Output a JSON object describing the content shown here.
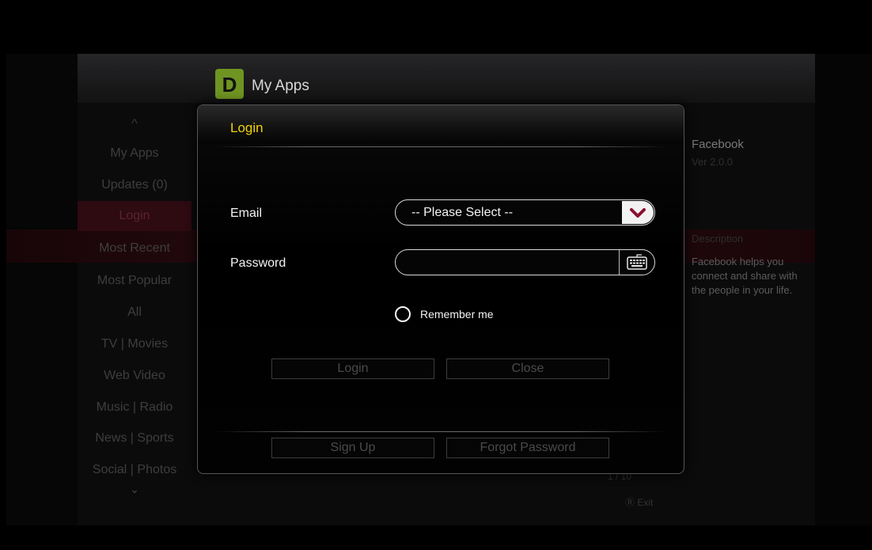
{
  "app": {
    "title": "My Apps",
    "logo_glyph": "D",
    "accent_color": "#6f9422"
  },
  "sidebar": {
    "up_arrow": "^",
    "down_arrow": "⌄",
    "items": [
      {
        "label": "My Apps"
      },
      {
        "label": "Updates (0)"
      },
      {
        "label": "Login",
        "selected": true
      },
      {
        "label": "Most Recent"
      },
      {
        "label": "Most Popular"
      },
      {
        "label": "All"
      },
      {
        "label": "TV | Movies"
      },
      {
        "label": "Web Video"
      },
      {
        "label": "Music | Radio"
      },
      {
        "label": "News | Sports"
      },
      {
        "label": "Social | Photos"
      }
    ]
  },
  "detail": {
    "name": "Facebook",
    "version": "Ver 2.0.0",
    "description_label": "Description",
    "description": "Facebook helps you connect and share with the people in your life."
  },
  "footer": {
    "pager": "1 / 10",
    "exit_label": "Exit"
  },
  "modal": {
    "title": "Login",
    "title_color": "#f2d300",
    "email_label": "Email",
    "email_value": "-- Please Select --",
    "password_label": "Password",
    "password_value": "",
    "remember_label": "Remember me",
    "remember_checked": false,
    "login_button": "Login",
    "close_button": "Close",
    "signup_button": "Sign Up",
    "forgot_button": "Forgot Password",
    "icons": {
      "dropdown": "chevron-down-icon",
      "keyboard": "keyboard-icon"
    }
  }
}
